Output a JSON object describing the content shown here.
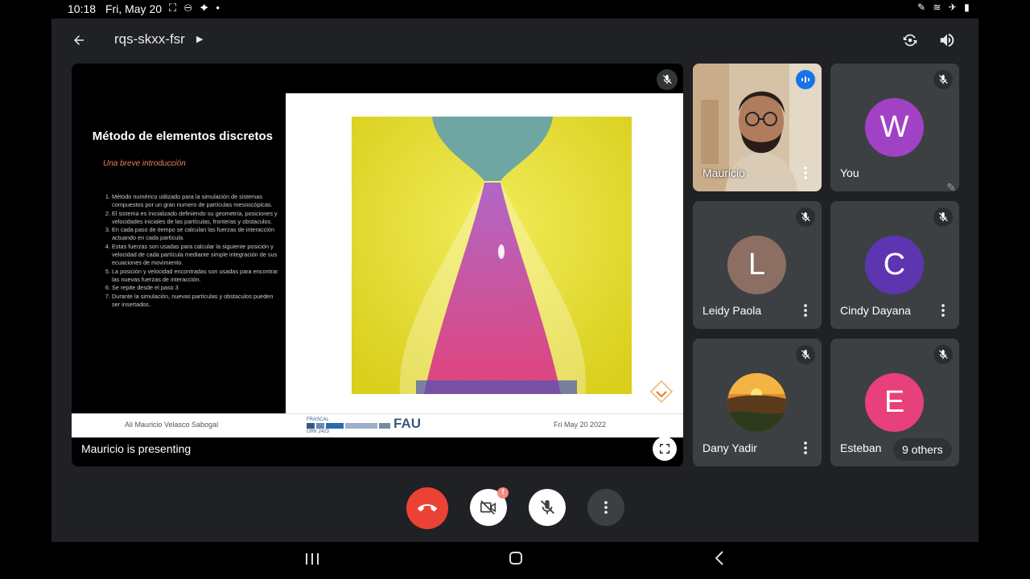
{
  "status_bar": {
    "time": "10:18",
    "date": "Fri, May 20"
  },
  "meeting": {
    "code": "rqs-skxx-fsr"
  },
  "presentation": {
    "presenting_label": "Mauricio is presenting",
    "slide": {
      "title": "Método de elementos discretos",
      "subtitle": "Una breve introducción",
      "items": [
        "Método numérico utilizado para la simulación de sistemas compuestos por un gran numero de partículas mesoscópicas.",
        "El sistema es inicializado definiendo su geometría, posiciones y velocidades iniciales de las partículas, fronteras y obstaculos.",
        "En cada paso de tiempo se calculan las fuerzas de interacción actuando en cada partícula.",
        "Estas fuerzas son usadas para calcular la siguiente posición y velocidad de cada partícula mediante simple integración de sus ecuaciones de movimiento.",
        "La posición y velocidad encontradas son usadas para encontrar las nuevas fuerzas de interacción.",
        "Se repite desde el paso 3",
        "Durante la simulación, nuevas partículas y obstaculos pueden ser insertados."
      ],
      "footer_author": "Ali Mauricio Velasco Sabogal",
      "footer_logo_text": "FRASCAL",
      "footer_logo_sub": "GRK 2423",
      "footer_fau": "FAU",
      "footer_date": "Fri May 20 2022"
    }
  },
  "participants": [
    {
      "name": "Mauricio",
      "type": "video"
    },
    {
      "name": "You",
      "initial": "W",
      "color": "#a142c5"
    },
    {
      "name": "Leidy Paola",
      "initial": "L",
      "color": "#8d6e63"
    },
    {
      "name": "Cindy Dayana",
      "initial": "C",
      "color": "#5e35b1"
    },
    {
      "name": "Dany Yadir",
      "type": "photo"
    },
    {
      "name": "Esteban",
      "initial": "E",
      "color": "#e8407a"
    }
  ],
  "others_label": "9 others",
  "colors": {
    "end_call": "#ea4335",
    "app_bg": "#202124",
    "tile_bg": "#3c4043"
  }
}
